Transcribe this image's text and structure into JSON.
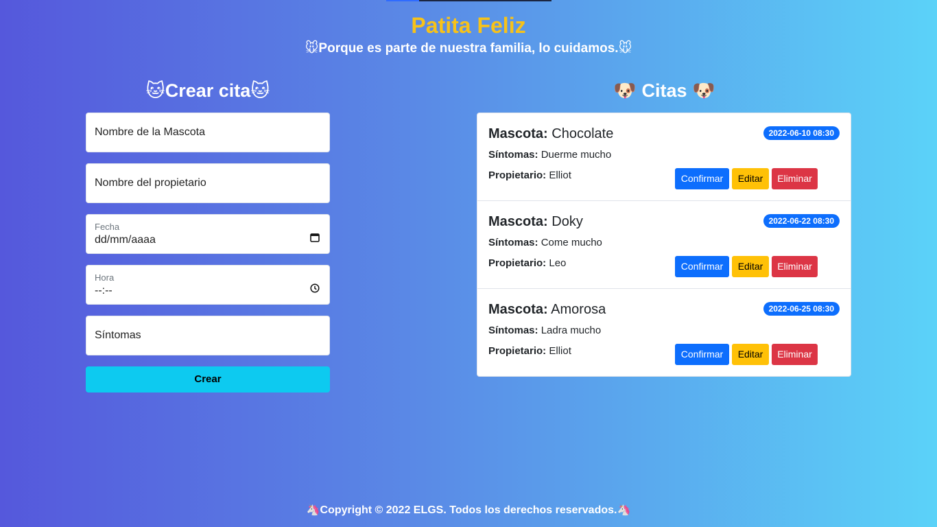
{
  "header": {
    "title": "Patita Feliz",
    "tagline": "Porque es parte de nuestra familia, lo cuidamos.",
    "tagline_icon": "🐭"
  },
  "form": {
    "title": "Crear cita",
    "title_icon": "🐱",
    "pet_name_placeholder": "Nombre de la Mascota",
    "owner_placeholder": "Nombre del propietario",
    "date_label": "Fecha",
    "date_value": "dd/mm/aaaa",
    "time_label": "Hora",
    "time_value": "--:--",
    "symptoms_placeholder": "Síntomas",
    "submit_label": "Crear"
  },
  "list": {
    "title": "Citas",
    "title_icon": "🐶",
    "pet_label": "Mascota:",
    "symptoms_label": "Síntomas:",
    "owner_label": "Propietario:",
    "confirm_label": "Confirmar",
    "edit_label": "Editar",
    "delete_label": "Eliminar",
    "items": [
      {
        "pet": "Chocolate",
        "symptoms": "Duerme mucho",
        "owner": "Elliot",
        "date": "2022-06-10 08:30"
      },
      {
        "pet": "Doky",
        "symptoms": "Come mucho",
        "owner": "Leo",
        "date": "2022-06-22 08:30"
      },
      {
        "pet": "Amorosa",
        "symptoms": "Ladra mucho",
        "owner": "Elliot",
        "date": "2022-06-25 08:30"
      }
    ]
  },
  "footer": {
    "text": "Copyright © 2022 ELGS. Todos los derechos reservados.",
    "icon": "🦄"
  },
  "colors": {
    "brand": "#f7c21a",
    "primary": "#0d6efd",
    "info": "#0dcaf0",
    "warning": "#ffc107",
    "danger": "#dc3545"
  }
}
